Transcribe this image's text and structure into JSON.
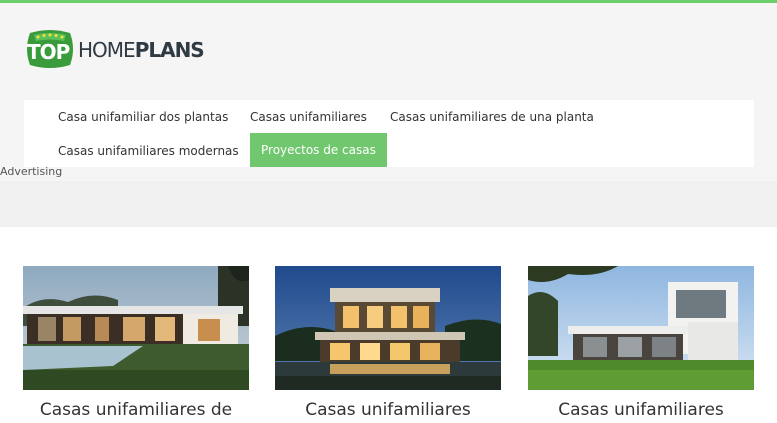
{
  "brand": {
    "badge": "TOP",
    "word_light": "HOME",
    "word_bold": "PLANS"
  },
  "nav": {
    "items": [
      {
        "label": "Casa unifamiliar dos plantas",
        "active": false
      },
      {
        "label": "Casas unifamiliares",
        "active": false
      },
      {
        "label": "Casas unifamiliares de una planta",
        "active": false
      },
      {
        "label": "Casas unifamiliares modernas",
        "active": false
      },
      {
        "label": "Proyectos de casas",
        "active": true
      }
    ]
  },
  "ad": {
    "label": "Advertising"
  },
  "cards": [
    {
      "title": "Casas unifamiliares de"
    },
    {
      "title": "Casas unifamiliares"
    },
    {
      "title": "Casas unifamiliares"
    }
  ],
  "colors": {
    "accent": "#71c76e",
    "top_line": "#6ccf6a",
    "text": "#333333"
  }
}
